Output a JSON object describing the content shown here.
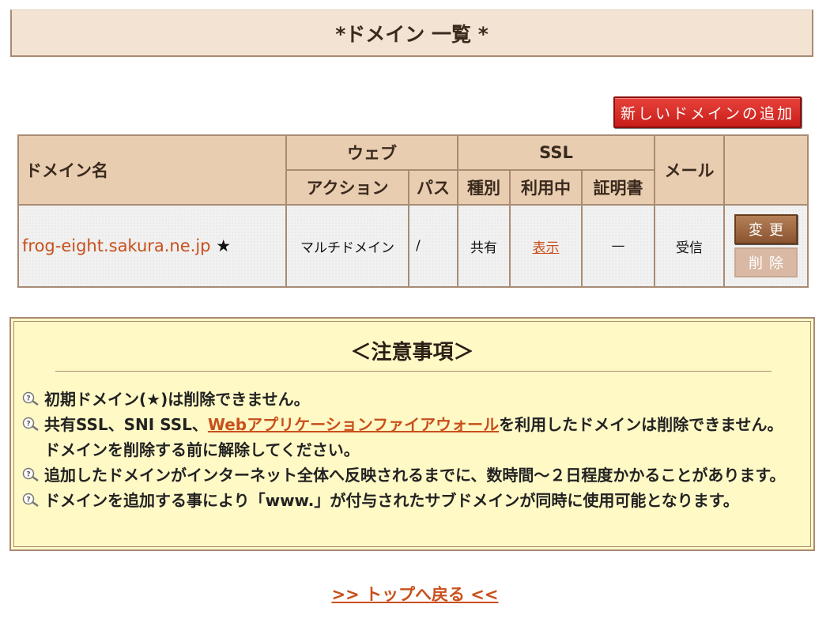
{
  "page": {
    "title": "*ドメイン 一覧 *"
  },
  "add_button": {
    "label": "新しいドメインの追加"
  },
  "table": {
    "headers": {
      "domain": "ドメイン名",
      "web": "ウェブ",
      "ssl": "SSL",
      "mail": "メール",
      "action": "アクション",
      "path": "パス",
      "type": "種別",
      "in_use": "利用中",
      "certificate": "証明書"
    },
    "rows": [
      {
        "domain": "frog-eight.sakura.ne.jp",
        "star": "★",
        "action": "マルチドメイン",
        "path": "/",
        "ssl_type": "共有",
        "ssl_in_use": "表示",
        "certificate": "—",
        "mail": "受信",
        "change_label": "変更",
        "delete_label": "削除"
      }
    ]
  },
  "notice": {
    "title": "＜注意事項＞",
    "items": [
      {
        "text": "初期ドメイン(★)は削除できません。"
      },
      {
        "pre": "共有SSL、SNI SSL、",
        "link": "Webアプリケーションファイアウォール",
        "post": "を利用したドメインは削除できません。ドメインを削除する前に解除してください。"
      },
      {
        "text": "追加したドメインがインターネット全体へ反映されるまでに、数時間〜２日程度かかることがあります。"
      },
      {
        "text": "ドメインを追加する事により「www.」が付与されたサブドメインが同時に使用可能となります。"
      }
    ]
  },
  "footer": {
    "back_link": ">> トップへ戻る <<"
  },
  "colors": {
    "header_bg": "#e9cdb0",
    "border": "#a88b73",
    "link": "#c8501c",
    "add_button": "#d8302a",
    "notice_bg": "#fff9c6"
  },
  "icons": {
    "notice_bullet": "magnifier-question-icon",
    "star": "star-icon"
  }
}
